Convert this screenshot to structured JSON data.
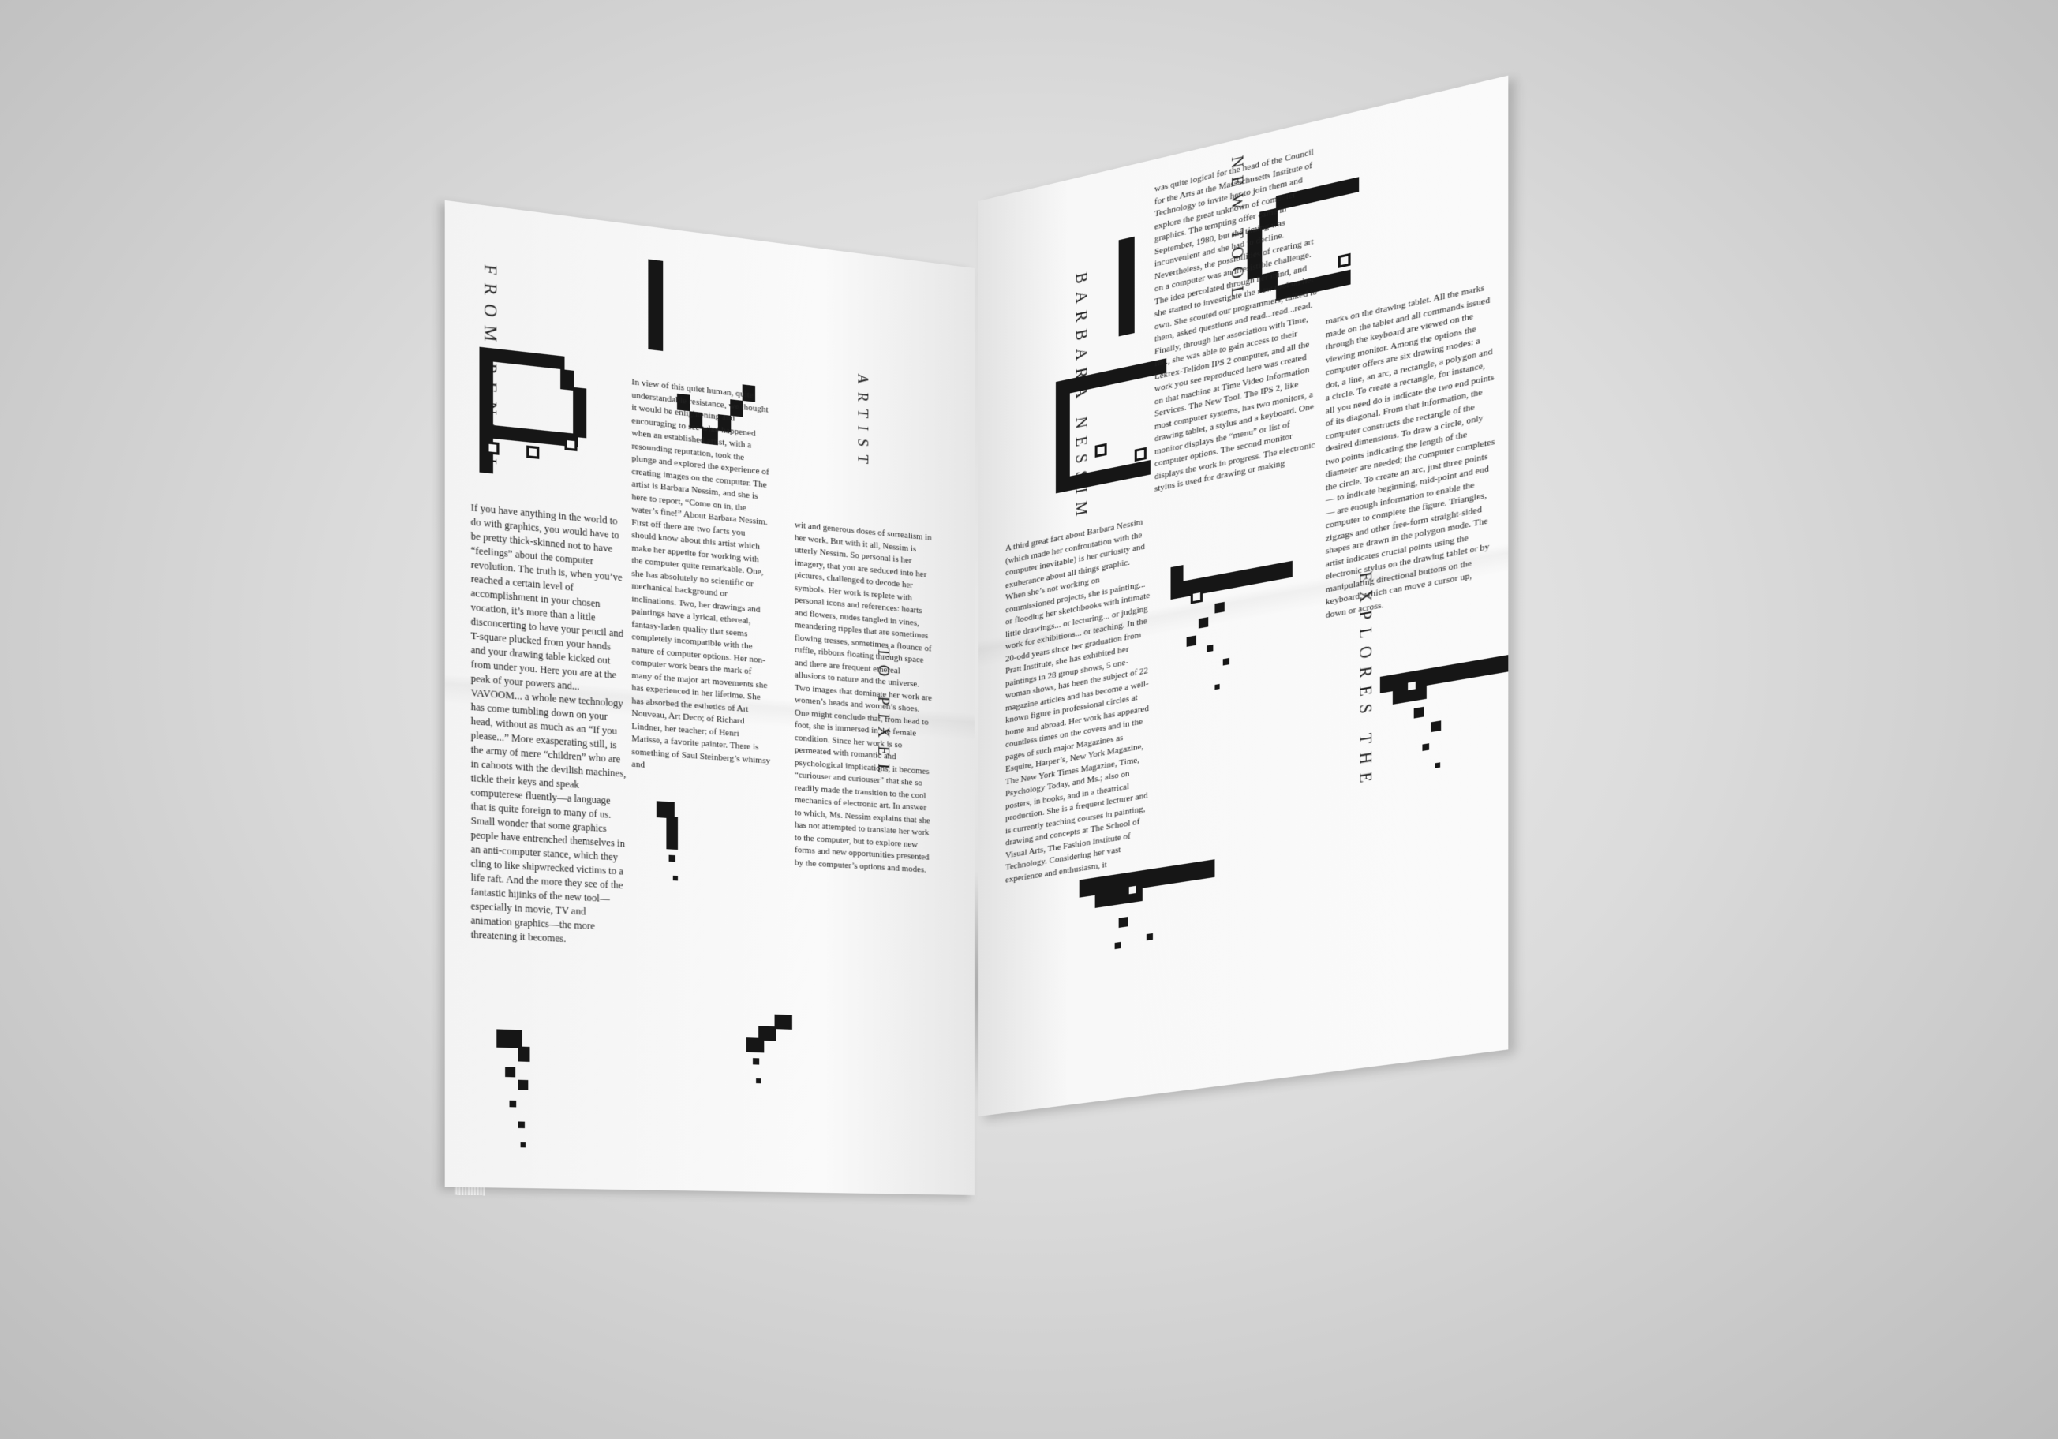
{
  "left_page": {
    "kicker_1": "FROM PENCIL",
    "kicker_2": "TO PIXEL",
    "kicker_3": "ARTIST",
    "column_1": "If you have anything in the world to do with graphics, you would have to be pretty thick-skinned not to have “feelings” about the computer revolution. The truth is, when you’ve reached a certain level of accomplishment in your chosen vocation, it’s more than a little disconcerting to have your pencil and T-square plucked from your hands and your drawing table kicked out from under you. Here you are at the peak of your powers and... VAVOOM... a whole new technology has come tumbling down on your head, without as much as an “If you please...” More exasperating still, is the army of mere “children” who are in cahoots with the devilish machines, tickle their keys and speak computerese fluently—a language that is quite foreign to many of us. Small wonder that some graphics people have entrenched themselves in an anti-computer stance, which they cling to like shipwrecked victims to a life raft. And the more they see of the fantastic hijinks of the new tool—especially in movie, TV and animation graphics—the more threatening it becomes.",
    "column_2": "In view of this quiet human, quite understandable resistance, we thought it would be enlightening and encouraging to see what happened when an established artist, with a resounding reputation, took the plunge and explored the experience of creating images on the computer. The artist is Barbara Nessim, and she is here to report, “Come on in, the water’s fine!” About Barbara Nessim. First off there are two facts you should know about this artist which make her appetite for working with the computer quite remarkable. One, she has absolutely no scientific or mechanical background or inclinations. Two, her drawings and paintings have a lyrical, ethereal, fantasy-laden quality that seems completely incompatible with the nature of computer options. Her non-computer work bears the mark of many of the major art movements she has experienced in her lifetime. She has absorbed the esthetics of Art Nouveau, Art Deco; of Richard Lindner, her teacher; of Henri Matisse, a favorite painter. There is something of Saul Steinberg’s whimsy and",
    "column_3": "wit and generous doses of surrealism in her work. But with it all, Nessim is utterly Nessim. So personal is her imagery, that you are seduced into her pictures, challenged to decode her symbols. Her work is replete with personal icons and references: hearts and flowers, nudes tangled in vines, meandering ripples that are sometimes flowing tresses, sometimes a flounce of ruffle, ribbons floating through space and there are frequent ethereal allusions to nature and the universe. Two images that dominate her work are women’s heads and women’s shoes. One might conclude that, from head to foot, she is immersed in the female condition. Since her work is so permeated with romantic and psychological implications, it becomes “curiouser and curiouser” that she so readily made the transition to the cool mechanics of electronic art. In answer to which, Ms. Nessim explains that she has not attempted to translate her work to the computer, but to explore new forms and new opportunities presented by the computer’s options and modes."
  },
  "right_page": {
    "kicker_1": "BARBARA NESSIM",
    "kicker_2": "NEW TOOL",
    "kicker_3": "EXPLORES THE",
    "column_1": "was quite logical for the head of the Council for the Arts at the Massachusetts Institute of Technology to invite her to join them and explore the great unknown of computer graphics. The tempting offer came in September, 1980, but the timing was inconvenient and she had to decline. Nevertheless, the possibilities of creating art on a computer was an irresistible challenge. The idea percolated through her mind, and she started to investigate the new tool on her own. She scouted our programmers, talked to them, asked questions and read...read...read. Finally, through her association with Time, Inc., she was able to gain access to their Lekrex-Telidon IPS 2 computer, and all the work you see reproduced here was created on that machine at Time Video Information Services. The New Tool. The IPS 2, like most computer systems, has two monitors, a drawing tablet, a stylus and a keyboard. One monitor displays the “menu” or list of computer options. The second monitor displays the work in progress. The electronic stylus is used for drawing or making",
    "column_2": "A third great fact about Barbara Nessim (which made her confrontation with the computer inevitable) is her curiosity and exuberance about all things graphic. When she’s not working on commissioned projects, she is painting... or flooding her sketchbooks with intimate little drawings... or lecturing... or judging work for exhibitions... or teaching. In the 20-odd years since her graduation from Pratt Institute, she has exhibited her paintings in 28 group shows, 5 one-woman shows, has been the subject of 22 magazine articles and has become a well-known figure in professional circles at home and abroad. Her work has appeared countless times on the covers and in the pages of such major Magazines as Esquire, Harper’s, New York Magazine, The New York Times Magazine, Time, Psychology Today, and Ms.; also on posters, in books, and in a theatrical production. She is a frequent lecturer and is currently teaching courses in painting, drawing and concepts at The School of Visual Arts, The Fashion Institute of Technology. Considering her vast experience and enthusiasm, it",
    "column_3": "marks on the drawing tablet. All the marks made on the tablet and all commands issued through the keyboard are viewed on the viewing monitor. Among the options the computer offers are six drawing modes: a dot, a line, an arc, a rectangle, a polygon and a circle. To create a rectangle, for instance, all you need do is indicate the two end points of its diagonal. From that information, the computer constructs the rectangle of the desired dimensions. To draw a circle, only two points indicating the length of the diameter are needed; the computer completes the circle. To create an arc, just three points — to indicate beginning, mid-point and end — are enough information to enable the computer to complete the figure. Triangles, zigzags and other free-form straight-sided shapes are drawn in the polygon mode. The artist indicates crucial points using the electronic stylus on the drawing tablet or by manipulating directional buttons on the keyboard, which can move a cursor up, down or across."
  }
}
